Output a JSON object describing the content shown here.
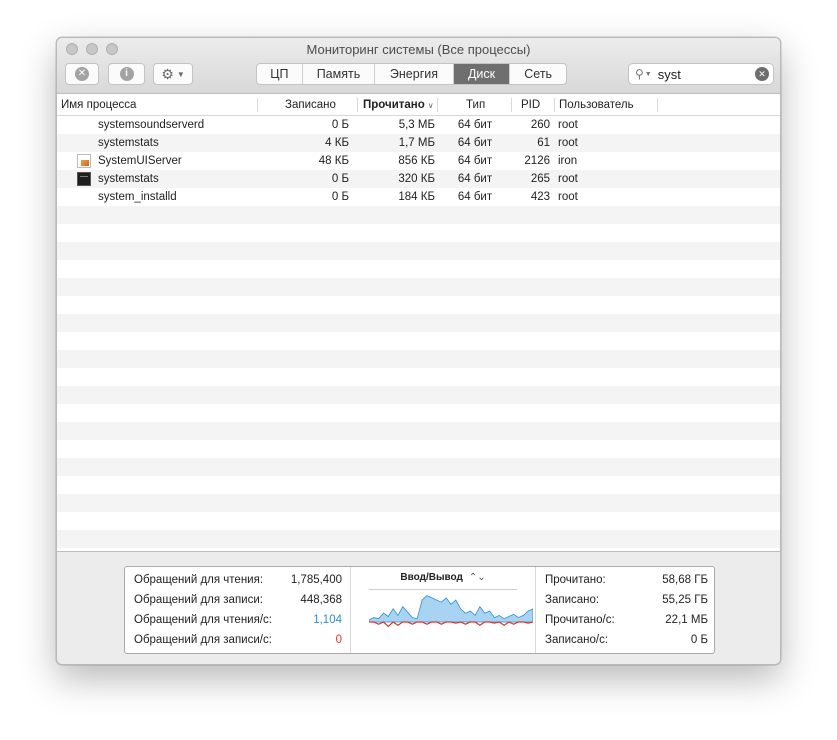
{
  "window": {
    "title": "Мониторинг системы (Все процессы)"
  },
  "toolbar": {
    "stop_icon": "x-circle-icon",
    "info_icon": "info-circle-icon",
    "gear_icon": "gear-icon",
    "tabs": [
      {
        "label": "ЦП",
        "active": false
      },
      {
        "label": "Память",
        "active": false
      },
      {
        "label": "Энергия",
        "active": false
      },
      {
        "label": "Диск",
        "active": true
      },
      {
        "label": "Сеть",
        "active": false
      }
    ],
    "search": {
      "value": "syst",
      "placeholder": ""
    }
  },
  "table": {
    "headers": [
      "Имя процесса",
      "Записано",
      "Прочитано",
      "Тип",
      "PID",
      "Пользователь"
    ],
    "sorted_column": "Прочитано",
    "rows": [
      {
        "name": "systemsoundserverd",
        "written": "0 Б",
        "read": "5,3 МБ",
        "type": "64 бит",
        "pid": "260",
        "user": "root",
        "icon": ""
      },
      {
        "name": "systemstats",
        "written": "4 КБ",
        "read": "1,7 МБ",
        "type": "64 бит",
        "pid": "61",
        "user": "root",
        "icon": ""
      },
      {
        "name": "SystemUIServer",
        "written": "48 КБ",
        "read": "856 КБ",
        "type": "64 бит",
        "pid": "2126",
        "user": "iron",
        "icon": "document-icon"
      },
      {
        "name": "systemstats",
        "written": "0 Б",
        "read": "320 КБ",
        "type": "64 бит",
        "pid": "265",
        "user": "root",
        "icon": "terminal-icon"
      },
      {
        "name": "system_installd",
        "written": "0 Б",
        "read": "184 КБ",
        "type": "64 бит",
        "pid": "423",
        "user": "root",
        "icon": ""
      }
    ]
  },
  "stats": {
    "left": [
      {
        "label": "Обращений для чтения:",
        "value": "1,785,400"
      },
      {
        "label": "Обращений для записи:",
        "value": "448,368"
      },
      {
        "label": "Обращений для чтения/с:",
        "value": "1,104"
      },
      {
        "label": "Обращений для записи/с:",
        "value": "0"
      }
    ],
    "chart_title": "Ввод/Вывод",
    "chart_read_color": "#2c8fd6",
    "chart_write_color": "#e0342b",
    "chart_read_series": [
      2,
      4,
      3,
      8,
      5,
      12,
      6,
      14,
      9,
      4,
      3,
      20,
      24,
      22,
      20,
      18,
      22,
      16,
      20,
      12,
      8,
      10,
      6,
      14,
      8,
      10,
      4,
      6,
      3,
      5,
      7,
      4,
      6,
      10,
      12
    ],
    "chart_write_series": [
      0,
      0,
      -2,
      0,
      -4,
      0,
      -3,
      0,
      0,
      -2,
      0,
      0,
      -2,
      0,
      0,
      -2,
      0,
      0,
      -1,
      0,
      -2,
      0,
      0,
      -3,
      0,
      0,
      -1,
      0,
      -3,
      0,
      -2,
      0,
      0,
      -1,
      0
    ],
    "right": [
      {
        "label": "Прочитано:",
        "value": "58,68 ГБ"
      },
      {
        "label": "Записано:",
        "value": "55,25 ГБ"
      },
      {
        "label": "Прочитано/с:",
        "value": "22,1 МБ"
      },
      {
        "label": "Записано/с:",
        "value": "0 Б"
      }
    ]
  }
}
